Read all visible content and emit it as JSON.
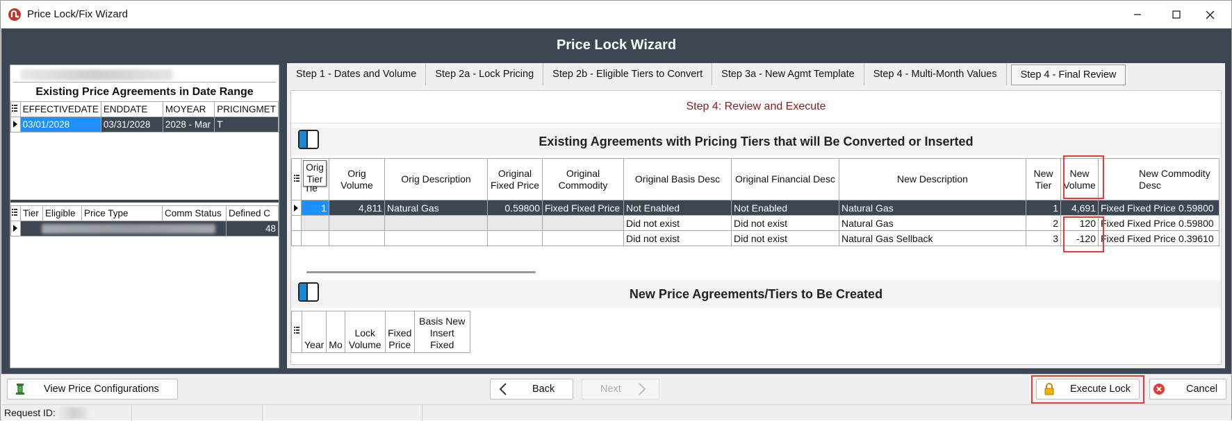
{
  "window": {
    "title": "Price Lock/Fix Wizard"
  },
  "header": {
    "title": "Price Lock Wizard"
  },
  "left": {
    "agreements_title": "Existing Price Agreements in Date Range",
    "agreements_columns": [
      "EFFECTIVEDATE",
      "ENDDATE",
      "MOYEAR",
      "PRICINGMET"
    ],
    "agreements_rows": [
      [
        "03/01/2028",
        "03/31/2028",
        "2028 - Mar",
        "T"
      ]
    ],
    "tiers_columns": [
      "Tier",
      "Eligible",
      "Price Type",
      "Comm Status",
      "Defined C"
    ],
    "tiers_row_value": "48"
  },
  "tabs": [
    "Step 1 - Dates and Volume",
    "Step 2a - Lock Pricing",
    "Step 2b - Eligible Tiers to Convert",
    "Step 3a - New Agmt Template",
    "Step 4 - Multi-Month Values",
    "Step 4 - Final Review"
  ],
  "step_header": "Step 4: Review and Execute",
  "existing_section_title": "Existing Agreements with Pricing Tiers that will Be Converted or Inserted",
  "existing_columns": {
    "orig_tier_tooltip": "Orig Tier",
    "orig_tier_under": "Tie",
    "orig_volume": "Orig Volume",
    "orig_description": "Orig Description",
    "original_fixed_price": "Original Fixed Price",
    "original_commodity": "Original Commodity",
    "original_basis_desc": "Original Basis Desc",
    "original_financial_desc": "Original Financial Desc",
    "new_description": "New Description",
    "new_tier": "New Tier",
    "new_volume": "New Volume",
    "new_commodity_desc": "New Commodity Desc"
  },
  "existing_rows": [
    {
      "orig_tier": "1",
      "orig_volume": "4,811",
      "orig_description": "Natural Gas",
      "original_fixed_price": "0.59800",
      "original_commodity": "Fixed Fixed Price",
      "original_basis_desc": "Not Enabled",
      "original_financial_desc": "Not Enabled",
      "new_description": "Natural Gas",
      "new_tier": "1",
      "new_volume": "4,691",
      "new_commodity_desc": "Fixed Fixed Price 0.59800"
    },
    {
      "orig_tier": "",
      "orig_volume": "",
      "orig_description": "",
      "original_fixed_price": "",
      "original_commodity": "",
      "original_basis_desc": "Did not exist",
      "original_financial_desc": "Did not exist",
      "new_description": "Natural Gas",
      "new_tier": "2",
      "new_volume": "120",
      "new_commodity_desc": "Fixed Fixed Price 0.59800"
    },
    {
      "orig_tier": "",
      "orig_volume": "",
      "orig_description": "",
      "original_fixed_price": "",
      "original_commodity": "",
      "original_basis_desc": "Did not exist",
      "original_financial_desc": "Did not exist",
      "new_description": "Natural Gas Sellback",
      "new_tier": "3",
      "new_volume": "-120",
      "new_commodity_desc": "Fixed Fixed Price 0.39610"
    }
  ],
  "new_section_title": "New Price Agreements/Tiers to Be Created",
  "new_columns": {
    "year": "Year",
    "mo": "Mo",
    "lock_volume": "Lock Volume",
    "fixed_price": "Fixed Price",
    "basis_new_insert_fixed": "Basis New Insert Fixed"
  },
  "buttons": {
    "view_price_configurations": "View Price Configurations",
    "back": "Back",
    "next": "Next",
    "execute_lock": "Execute Lock",
    "cancel": "Cancel"
  },
  "status": {
    "request_id_label": "Request ID:"
  },
  "colors": {
    "header_bg": "#3d4653",
    "selection": "#1e90ff",
    "highlight_box": "#e03a3a",
    "step_header_text": "#8b1a1a"
  },
  "icons": {
    "app": "app-logo-icon",
    "minimize": "minimize-icon",
    "maximize": "maximize-icon",
    "close": "close-icon",
    "panel": "panel-toggle-icon",
    "chooser": "column-chooser-icon",
    "price_config": "price-config-icon",
    "back": "chevron-left-icon",
    "next": "chevron-right-icon",
    "lock": "lock-icon",
    "cancel": "cancel-icon"
  }
}
